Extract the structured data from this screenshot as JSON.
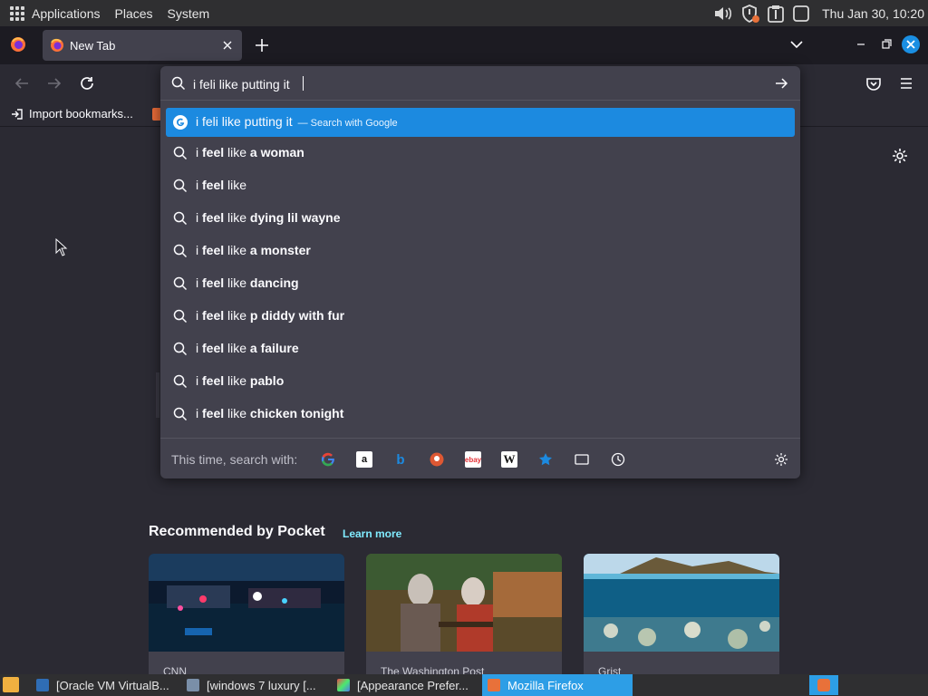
{
  "system_panel": {
    "menus": [
      "Applications",
      "Places",
      "System"
    ],
    "clock": "Thu Jan 30, 10:20"
  },
  "browser": {
    "tab_title": "New Tab",
    "bookmark_import": "Import bookmarks..."
  },
  "urlbar": {
    "value": "i feli like putting it",
    "results": [
      {
        "typed": "i feli like putting it",
        "action": "— Search with Google",
        "selected": true
      },
      {
        "pre": "i ",
        "bold1": "feel",
        "mid": " like ",
        "bold2": "a woman"
      },
      {
        "pre": "i ",
        "bold1": "feel",
        "mid": " like",
        "bold2": ""
      },
      {
        "pre": "i ",
        "bold1": "feel",
        "mid": " like ",
        "bold2": "dying lil wayne"
      },
      {
        "pre": "i ",
        "bold1": "feel",
        "mid": " like ",
        "bold2": "a monster"
      },
      {
        "pre": "i ",
        "bold1": "feel",
        "mid": " like ",
        "bold2": "dancing"
      },
      {
        "pre": "i ",
        "bold1": "feel",
        "mid": " like ",
        "bold2": "p diddy with fur"
      },
      {
        "pre": "i ",
        "bold1": "feel",
        "mid": " like ",
        "bold2": "a failure"
      },
      {
        "pre": "i ",
        "bold1": "feel",
        "mid": " like ",
        "bold2": "pablo"
      },
      {
        "pre": "i ",
        "bold1": "feel",
        "mid": " like ",
        "bold2": "chicken tonight"
      }
    ],
    "oneoff_label": "This time, search with:",
    "engines": [
      "google",
      "amazon",
      "bing",
      "duckduckgo",
      "ebay",
      "wikipedia",
      "bookmarks",
      "tabs",
      "history"
    ]
  },
  "pocket": {
    "title": "Recommended by Pocket",
    "learn_more": "Learn more",
    "cards": [
      {
        "source": "CNN"
      },
      {
        "source": "The Washington Post"
      },
      {
        "source": "Grist"
      }
    ]
  },
  "taskbar": {
    "items": [
      {
        "label": "[Oracle VM VirtualB...",
        "active": false
      },
      {
        "label": "[windows 7 luxury [...",
        "active": false
      },
      {
        "label": "[Appearance Prefer...",
        "active": false
      },
      {
        "label": "Mozilla Firefox",
        "active": true
      }
    ]
  },
  "colors": {
    "accent": "#1c8ae0",
    "link": "#80ebff",
    "panel_bg": "#42414d",
    "page_bg": "#2b2a33"
  }
}
